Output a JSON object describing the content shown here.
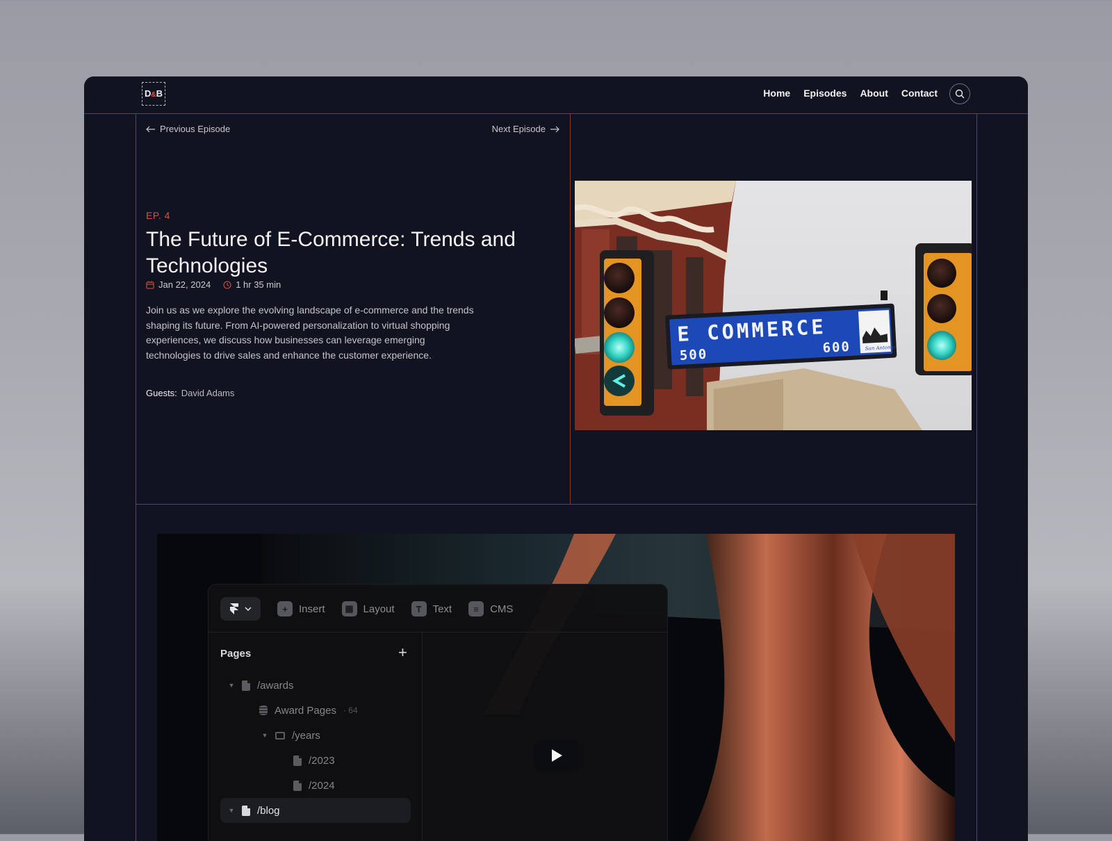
{
  "header": {
    "logo": {
      "left": "D",
      "amp": "&",
      "right": "B"
    },
    "nav": [
      "Home",
      "Episodes",
      "About",
      "Contact"
    ]
  },
  "episode_nav": {
    "previous": "Previous Episode",
    "next": "Next Episode"
  },
  "episode": {
    "label": "EP. 4",
    "title": "The Future of E-Commerce: Trends and Technologies",
    "date": "Jan 22, 2024",
    "duration": "1 hr 35 min",
    "description": "Join us as we explore the evolving landscape of e-commerce and the trends shaping its future. From AI-powered personalization to virtual shopping experiences, we discuss how businesses can leverage emerging technologies to drive sales and enhance the customer experience.",
    "guests_label": "Guests:",
    "guests": "David Adams"
  },
  "hero_sign": {
    "street": "E COMMERCE",
    "left_number": "500",
    "right_number": "600",
    "city": "San Antonio"
  },
  "video": {
    "toolbar": [
      "Insert",
      "Layout",
      "Text",
      "CMS"
    ],
    "pages_title": "Pages",
    "tree": [
      {
        "label": "/awards"
      },
      {
        "label": "Award Pages",
        "count": "64"
      },
      {
        "label": "/years"
      },
      {
        "label": "/2023"
      },
      {
        "label": "/2024"
      },
      {
        "label": "/blog"
      }
    ]
  },
  "colors": {
    "accent": "#d4513a",
    "background": "#111320",
    "border": "#8a3826"
  }
}
